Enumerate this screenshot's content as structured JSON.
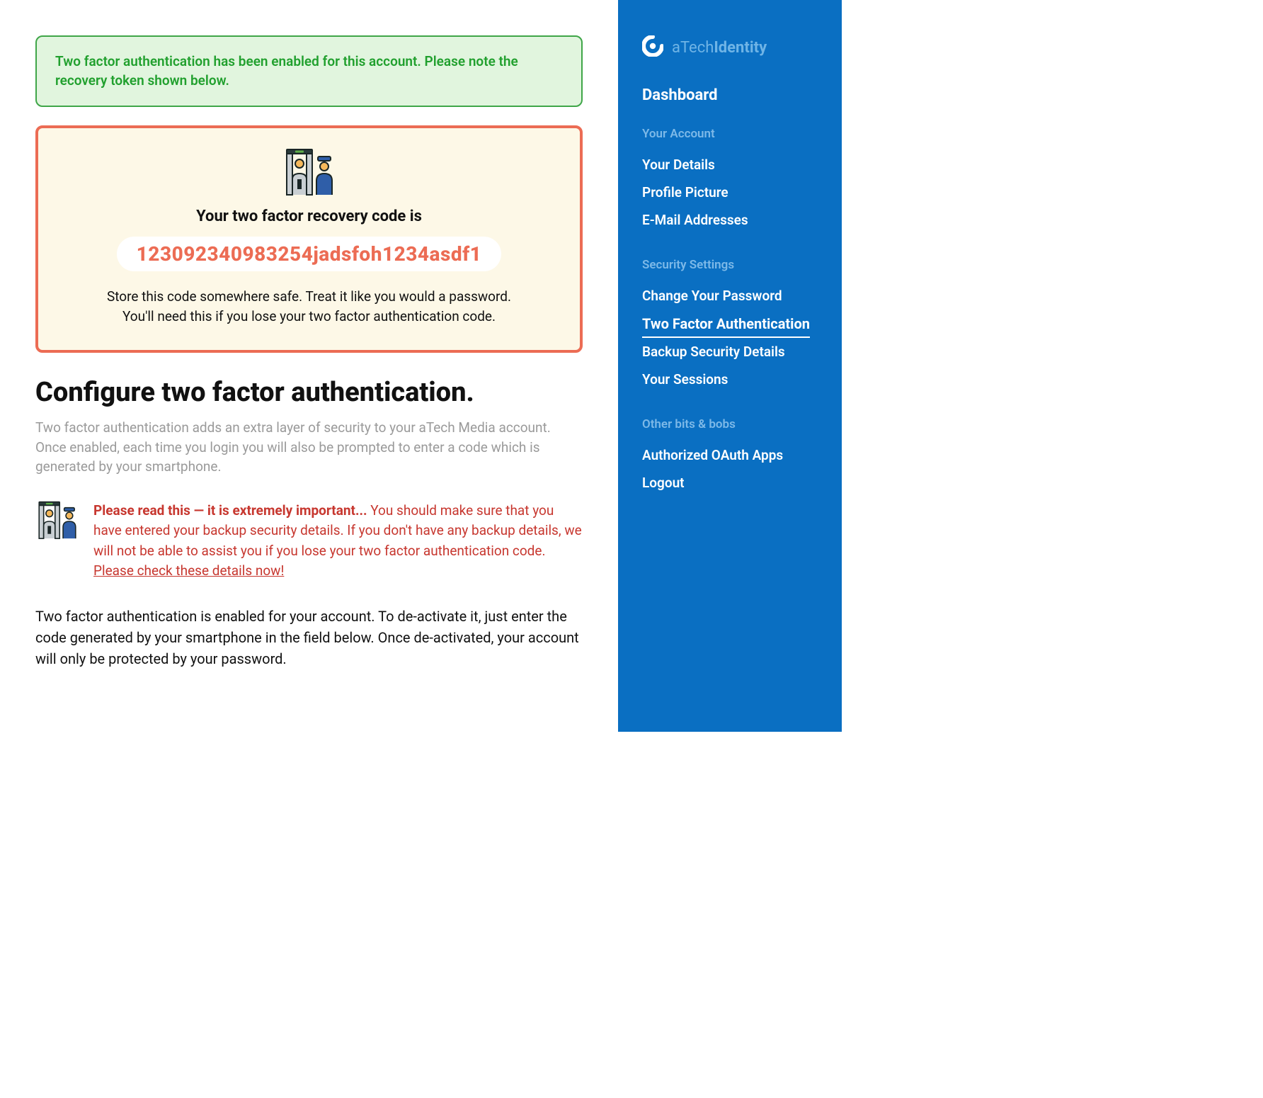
{
  "alert": {
    "message": "Two factor authentication has been enabled for this account. Please note the recovery token shown below."
  },
  "recovery": {
    "title": "Your two factor recovery code is",
    "code": "123092340983254jadsfoh1234asdf1",
    "note": "Store this code somewhere safe. Treat it like you would a password. You'll need this if you lose your two factor authentication code."
  },
  "page": {
    "title": "Configure two factor authentication.",
    "subtitle": "Two factor authentication adds an extra layer of security to your aTech Media account. Once enabled, each time you login you will also be prompted to enter a code which is generated by your smartphone."
  },
  "warning": {
    "lead": "Please read this — it is extremely important...",
    "body": " You should make sure that you have entered your backup security details. If you don't have any backup details, we will not be able to assist you if you lose your two factor authentication code. ",
    "link": "Please check these details now!"
  },
  "deactivate_text": "Two factor authentication is enabled for your account. To de-activate it, just enter the code generated by your smartphone in the field below. Once de-activated, your account will only be protected by your password.",
  "brand": {
    "prefix": "aTech",
    "suffix": "Identity"
  },
  "sidebar": {
    "dashboard": "Dashboard",
    "sections": [
      {
        "label": "Your Account",
        "items": [
          "Your Details",
          "Profile Picture",
          "E-Mail Addresses"
        ]
      },
      {
        "label": "Security Settings",
        "items": [
          "Change Your Password",
          "Two Factor Authentication",
          "Backup Security Details",
          "Your Sessions"
        ],
        "active_index": 1
      },
      {
        "label": "Other bits & bobs",
        "items": [
          "Authorized OAuth Apps",
          "Logout"
        ]
      }
    ]
  }
}
